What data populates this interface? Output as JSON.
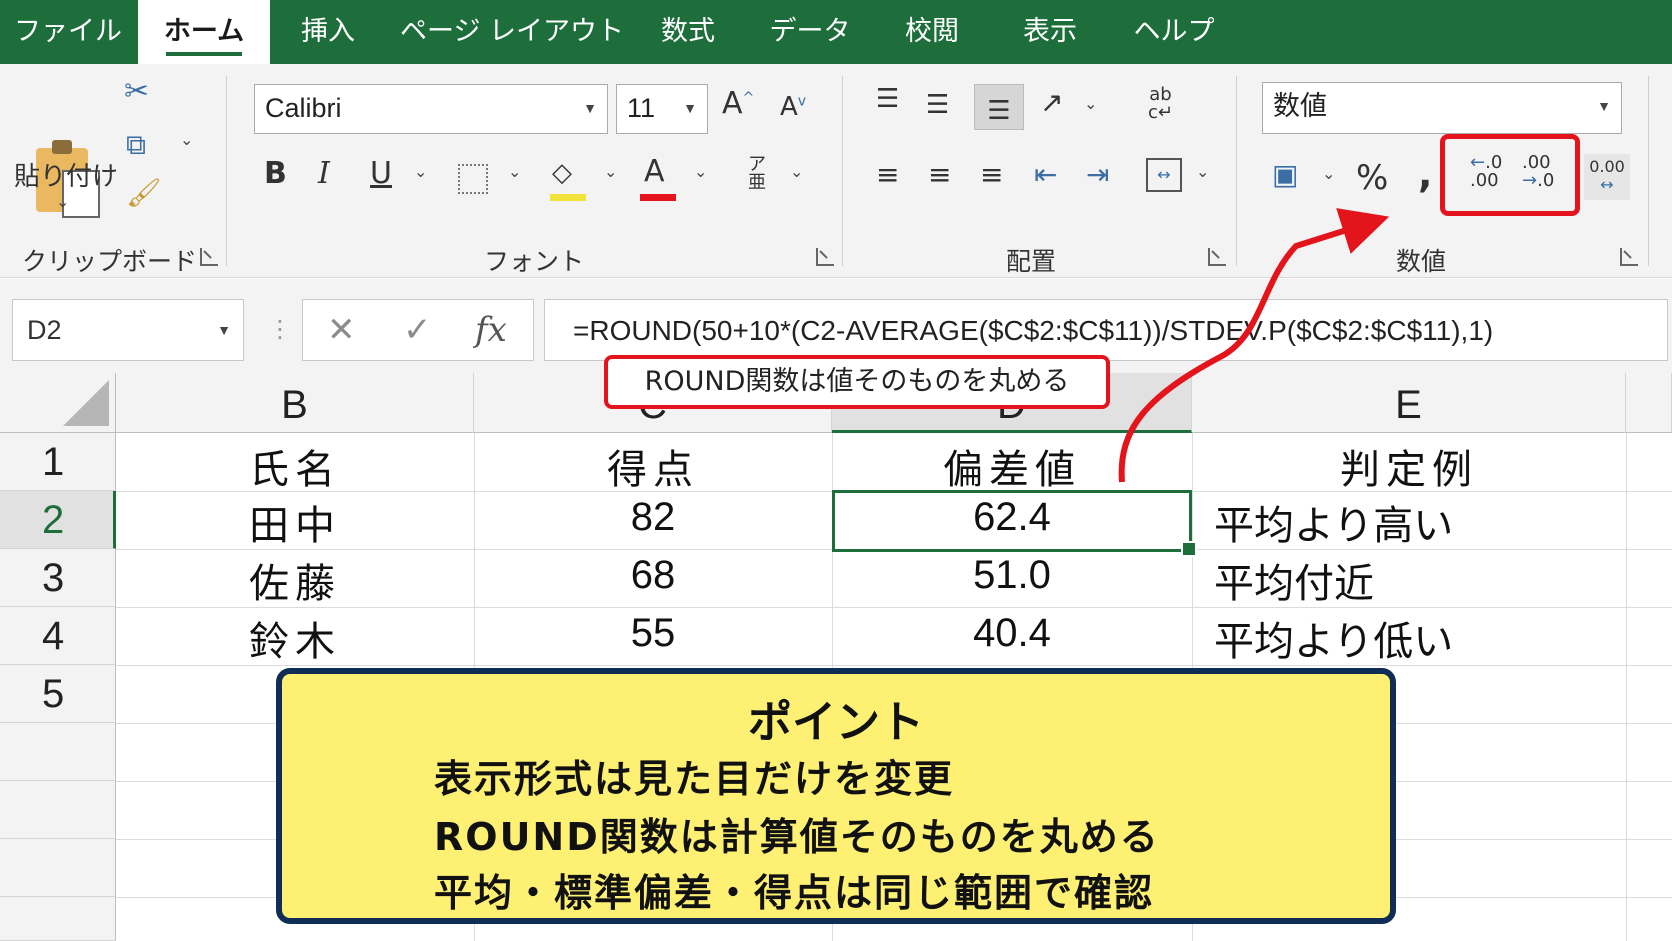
{
  "tabs": [
    "ファイル",
    "ホーム",
    "挿入",
    "ページ レイアウト",
    "数式",
    "データ",
    "校閲",
    "表示",
    "ヘルプ"
  ],
  "active_tab": "ホーム",
  "ribbon": {
    "clipboard": {
      "paste_label": "貼り付け",
      "group_label": "クリップボード"
    },
    "font": {
      "font_name": "Calibri",
      "font_size": "11",
      "group_label": "フォント",
      "font_color": "#e3141b",
      "fill_color": "#f2e33a"
    },
    "alignment": {
      "group_label": "配置"
    },
    "number": {
      "format": "数値",
      "percent": "%",
      "comma": ",",
      "increase_decimal": ".00",
      "decrease_decimal": ".0",
      "currency_like": "0.00",
      "group_label": "数値"
    }
  },
  "formula_bar": {
    "name_box": "D2",
    "fx_label": "fx",
    "formula": "=ROUND(50+10*(C2-AVERAGE($C$2:$C$11))/STDEV.P($C$2:$C$11),1)"
  },
  "callout": "ROUND関数は値そのものを丸める",
  "grid": {
    "columns": [
      "B",
      "C",
      "D",
      "E"
    ],
    "selected_column": "D",
    "rows": [
      "1",
      "2",
      "3",
      "4",
      "5"
    ],
    "selected_row": "2",
    "headers": [
      "氏名",
      "得点",
      "偏差値",
      "判定例"
    ],
    "data": [
      [
        "田中",
        "82",
        "62.4",
        "平均より高い"
      ],
      [
        "佐藤",
        "68",
        "51.0",
        "平均付近"
      ],
      [
        "鈴木",
        "55",
        "40.4",
        "平均より低い"
      ]
    ]
  },
  "point_box": {
    "title": "ポイント",
    "lines": [
      "表示形式は見た目だけを変更",
      "ROUND関数は計算値そのものを丸める",
      "平均・標準偏差・得点は同じ範囲で確認"
    ]
  },
  "colors": {
    "excel_green": "#1e6e3b",
    "highlight_red": "#e3141b",
    "point_bg": "#fdf072",
    "point_border": "#0f2d55"
  }
}
